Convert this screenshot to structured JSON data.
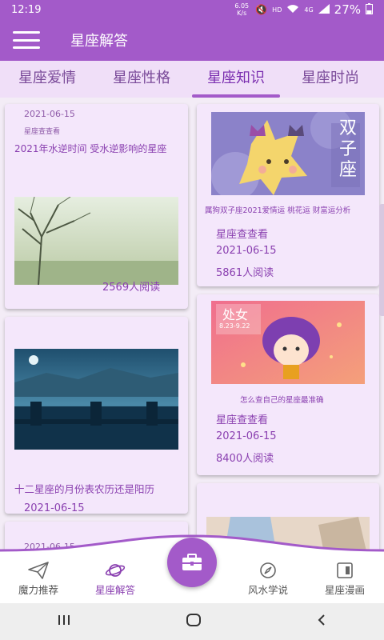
{
  "status": {
    "time": "12:19",
    "net": "6.05 K/s",
    "hd": "HD",
    "sig": "4G",
    "battery": "27%"
  },
  "header": {
    "title": "星座解答"
  },
  "tabs": [
    "星座爱情",
    "星座性格",
    "星座知识",
    "星座时尚"
  ],
  "active_tab": 2,
  "cards": {
    "left1": {
      "date": "2021-06-15",
      "source": "星座查查看",
      "title": "2021年水逆时间 受水逆影响的星座",
      "reads": "2569人阅读"
    },
    "left2": {
      "title": "十二星座的月份表农历还是阳历",
      "date": "2021-06-15"
    },
    "left3": {
      "date": "2021-06-15"
    },
    "right1": {
      "caption": "属狗双子座2021爱情运 桃花运 财富运分析",
      "source": "星座查查看",
      "date": "2021-06-15",
      "reads": "5861人阅读",
      "badge": "双子座"
    },
    "right2": {
      "caption": "怎么查自己的星座最准确",
      "source": "星座查查看",
      "date": "2021-06-15",
      "reads": "8400人阅读",
      "badge": "处女",
      "badge_dates": "8.23-9.22"
    }
  },
  "bottom_nav": [
    "魔力推荐",
    "星座解答",
    "风水学说",
    "星座漫画"
  ],
  "colors": {
    "primary": "#a35ac9",
    "tab_bg": "#f0dff8",
    "card_bg": "#f4e7fb",
    "text_purple": "#8a40b0"
  }
}
